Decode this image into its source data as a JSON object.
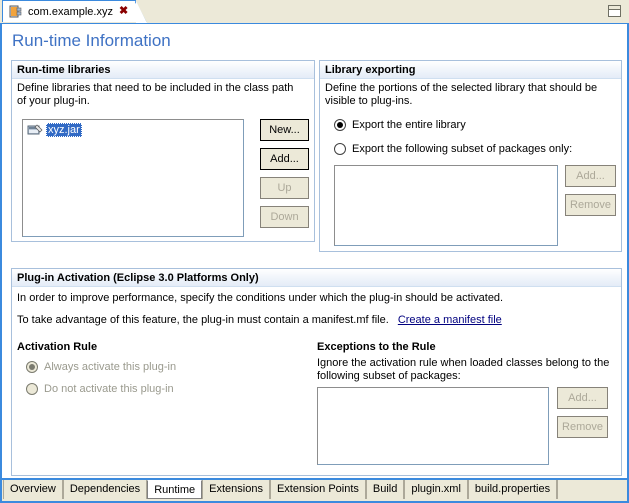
{
  "window": {
    "tab": {
      "icon": "plugin-icon",
      "title": "com.example.xyz",
      "close_label": "✖"
    },
    "restore_icon": "restore-window-icon"
  },
  "page": {
    "title": "Run-time Information"
  },
  "runtime_libraries": {
    "header": "Run-time libraries",
    "description": "Define libraries that need to be included in the class path of your plug-in.",
    "items": [
      {
        "icon": "jar-icon",
        "label": "xyz.jar",
        "selected": true
      }
    ],
    "buttons": [
      {
        "label": "New...",
        "enabled": true
      },
      {
        "label": "Add...",
        "enabled": true
      },
      {
        "label": "Up",
        "enabled": false
      },
      {
        "label": "Down",
        "enabled": false
      }
    ]
  },
  "library_exporting": {
    "header": "Library exporting",
    "description": "Define the portions of the selected library that should be visible to plug-ins.",
    "radios": [
      {
        "label": "Export the entire library",
        "checked": true
      },
      {
        "label": "Export the following subset of packages only:",
        "checked": false
      }
    ],
    "list_items": [],
    "buttons": [
      {
        "label": "Add...",
        "enabled": false
      },
      {
        "label": "Remove",
        "enabled": false
      }
    ]
  },
  "plugin_activation": {
    "header": "Plug-in Activation (Eclipse 3.0 Platforms Only)",
    "line1": "In order to improve performance, specify the conditions under which the plug-in should be activated.",
    "line2_prefix": "To take advantage of this feature, the plug-in must contain a manifest.mf file.",
    "link_label": "Create a manifest file",
    "activation_rule": {
      "heading": "Activation Rule",
      "radios": [
        {
          "label": "Always activate this plug-in",
          "checked": true,
          "enabled": false
        },
        {
          "label": "Do not activate this plug-in",
          "checked": false,
          "enabled": false
        }
      ]
    },
    "exceptions": {
      "heading": "Exceptions to the Rule",
      "description": "Ignore the activation rule when loaded classes belong to the following subset of packages:",
      "list_items": [],
      "buttons": [
        {
          "label": "Add...",
          "enabled": false
        },
        {
          "label": "Remove",
          "enabled": false
        }
      ]
    }
  },
  "page_tabs": [
    {
      "label": "Overview",
      "active": false
    },
    {
      "label": "Dependencies",
      "active": false
    },
    {
      "label": "Runtime",
      "active": true
    },
    {
      "label": "Extensions",
      "active": false
    },
    {
      "label": "Extension Points",
      "active": false
    },
    {
      "label": "Build",
      "active": false
    },
    {
      "label": "plugin.xml",
      "active": false
    },
    {
      "label": "build.properties",
      "active": false
    }
  ],
  "colors": {
    "accent_blue": "#3b8ade",
    "title_blue": "#3f72c4",
    "selection_blue": "#316ac5",
    "link_blue": "#00007f",
    "face": "#ece9d8"
  }
}
